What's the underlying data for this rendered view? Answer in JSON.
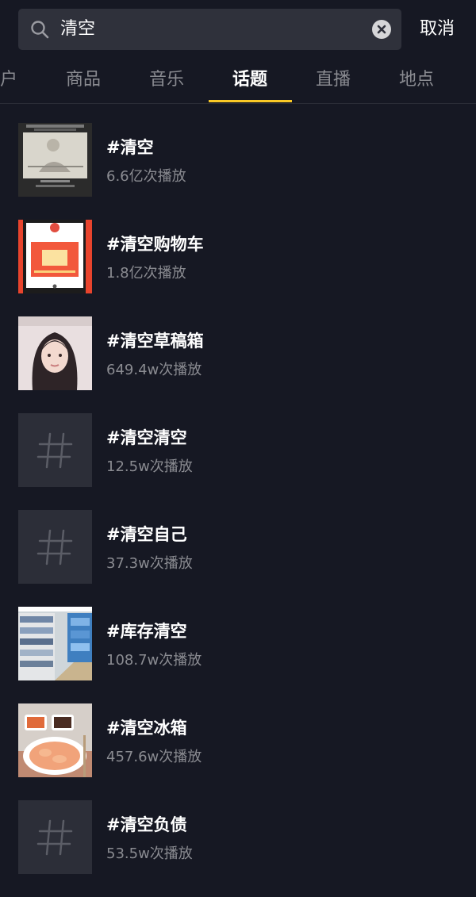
{
  "search": {
    "query": "清空",
    "cancel_label": "取消"
  },
  "tabs": [
    {
      "label": "户",
      "active": false
    },
    {
      "label": "商品",
      "active": false
    },
    {
      "label": "音乐",
      "active": false
    },
    {
      "label": "话题",
      "active": true
    },
    {
      "label": "直播",
      "active": false
    },
    {
      "label": "地点",
      "active": false
    }
  ],
  "results": [
    {
      "name": "#清空",
      "plays": "6.6亿次播放",
      "thumb": "photo-sketch"
    },
    {
      "name": "#清空购物车",
      "plays": "1.8亿次播放",
      "thumb": "photo-red-coupon"
    },
    {
      "name": "#清空草稿箱",
      "plays": "649.4w次播放",
      "thumb": "photo-girl-portrait"
    },
    {
      "name": "#清空清空",
      "plays": "12.5w次播放",
      "thumb": "hashtag-icon"
    },
    {
      "name": "#清空自己",
      "plays": "37.3w次播放",
      "thumb": "hashtag-icon"
    },
    {
      "name": "#库存清空",
      "plays": "108.7w次播放",
      "thumb": "photo-store-shelves"
    },
    {
      "name": "#清空冰箱",
      "plays": "457.6w次播放",
      "thumb": "photo-shrimp-dish"
    },
    {
      "name": "#清空负债",
      "plays": "53.5w次播放",
      "thumb": "hashtag-icon"
    }
  ],
  "colors": {
    "background": "#161823",
    "search_bg": "#2f313b",
    "accent": "#fac926",
    "muted_text": "#8a8b91"
  }
}
